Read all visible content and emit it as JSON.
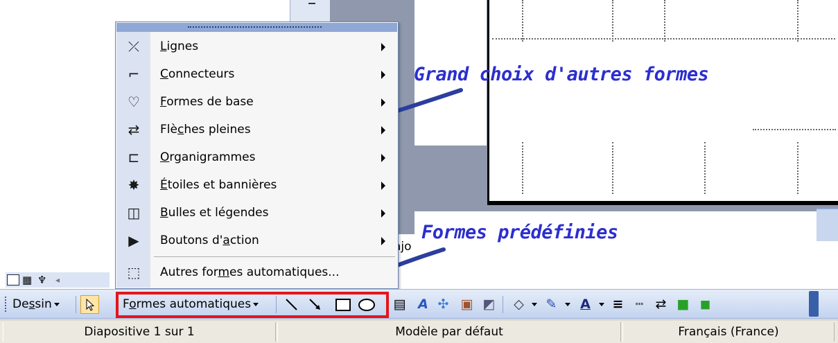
{
  "annotations": {
    "top": "Grand choix d'autres formes",
    "bottom": "Formes prédéfinies"
  },
  "partial_text": "ajo",
  "menu": {
    "items": [
      {
        "label_pre": "",
        "label_ul": "L",
        "label_post": "ignes",
        "icon": "lines-icon",
        "glyph": "⤫",
        "submenu": true
      },
      {
        "label_pre": "",
        "label_ul": "C",
        "label_post": "onnecteurs",
        "icon": "connectors-icon",
        "glyph": "⌐",
        "submenu": true
      },
      {
        "label_pre": "",
        "label_ul": "F",
        "label_post": "ormes de base",
        "icon": "basic-shapes-icon",
        "glyph": "♡",
        "submenu": true
      },
      {
        "label_pre": "Flè",
        "label_ul": "c",
        "label_post": "hes pleines",
        "icon": "block-arrows-icon",
        "glyph": "⇄",
        "submenu": true
      },
      {
        "label_pre": "",
        "label_ul": "O",
        "label_post": "rganigrammes",
        "icon": "flowchart-icon",
        "glyph": "⊏",
        "submenu": true
      },
      {
        "label_pre": "",
        "label_ul": "É",
        "label_post": "toiles et bannières",
        "icon": "stars-banners-icon",
        "glyph": "✸",
        "submenu": true
      },
      {
        "label_pre": "",
        "label_ul": "B",
        "label_post": "ulles et légendes",
        "icon": "callouts-icon",
        "glyph": "◫",
        "submenu": true
      },
      {
        "label_pre": "Boutons d'",
        "label_ul": "a",
        "label_post": "ction",
        "icon": "action-buttons-icon",
        "glyph": "▶",
        "submenu": true
      },
      {
        "label_pre": "Autres for",
        "label_ul": "m",
        "label_post": "es automatiques...",
        "icon": "more-autoshapes-icon",
        "glyph": "⬚",
        "submenu": false
      }
    ]
  },
  "toolbar": {
    "draw_label_pre": "De",
    "draw_label_ul": "s",
    "draw_label_post": "sin",
    "autoshapes_label_pre": "F",
    "autoshapes_label_ul": "o",
    "autoshapes_label_post": "rmes automatiques",
    "highlight_color": "#e5151b"
  },
  "statusbar": {
    "slide": "Diapositive 1 sur 1",
    "template": "Modèle par défaut",
    "language": "Français (France)"
  }
}
